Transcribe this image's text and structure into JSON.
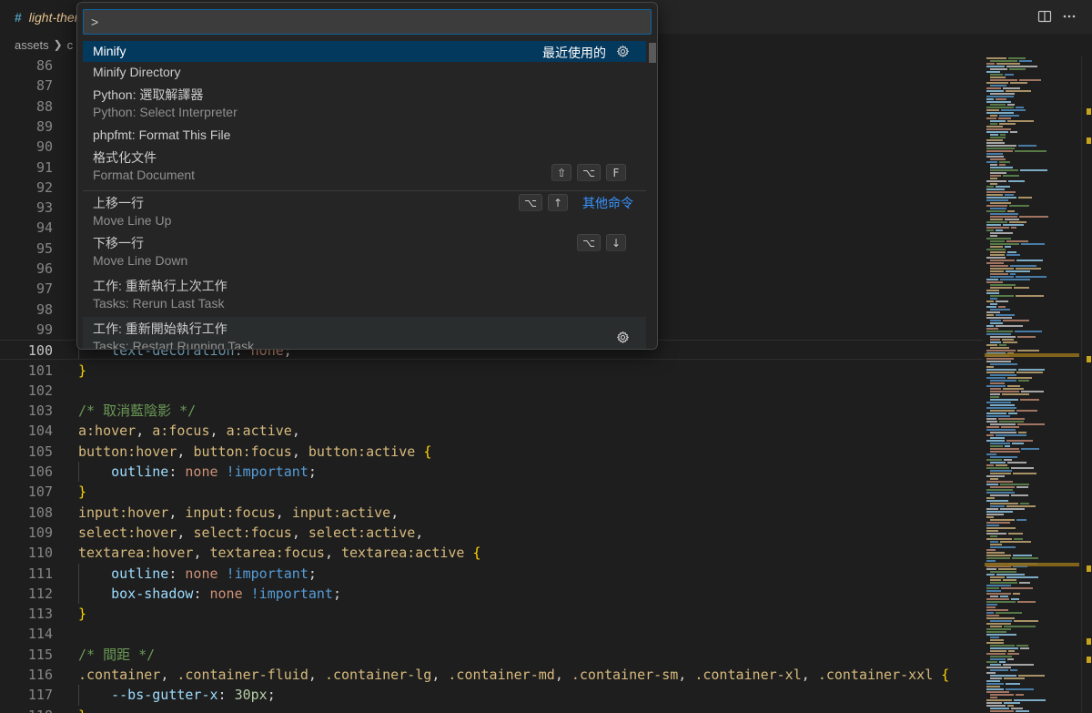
{
  "tab": {
    "icon": "#",
    "title": "light-theme.scss"
  },
  "top_actions": {
    "split_icon": "split-editor-icon",
    "more_icon": "more-actions-icon"
  },
  "breadcrumb": {
    "root": "assets",
    "next": "c"
  },
  "palette": {
    "input_value": ">",
    "items": [
      {
        "label": "Minify",
        "detail": "",
        "right_label": "最近使用的",
        "selected": true,
        "keys": [],
        "gear": true
      },
      {
        "label": "Minify Directory",
        "detail": "",
        "keys": []
      },
      {
        "label": "Python: 選取解譯器",
        "detail": "Python: Select Interpreter",
        "keys": []
      },
      {
        "label": "phpfmt: Format This File",
        "detail": "",
        "keys": []
      },
      {
        "label": "格式化文件",
        "detail": "Format Document",
        "keys": [
          "⇧",
          "⌥",
          "F"
        ]
      },
      {
        "label": "上移一行",
        "detail": "Move Line Up",
        "keys": [
          "⌥",
          "↑"
        ],
        "right_label": "其他命令"
      },
      {
        "label": "下移一行",
        "detail": "Move Line Down",
        "keys": [
          "⌥",
          "↓"
        ]
      },
      {
        "label": "工作: 重新執行上次工作",
        "detail": "Tasks: Rerun Last Task",
        "keys": []
      },
      {
        "label": "工作: 重新開始執行工作",
        "detail": "Tasks: Restart Running Task",
        "keys": [],
        "gear": true
      }
    ],
    "accent_color": "#3794ff"
  },
  "editor": {
    "current_line": 100,
    "lines": [
      {
        "n": 86,
        "tokens": []
      },
      {
        "n": 87,
        "tokens": []
      },
      {
        "n": 88,
        "tokens": []
      },
      {
        "n": 89,
        "tokens": []
      },
      {
        "n": 90,
        "tokens": []
      },
      {
        "n": 91,
        "tokens": []
      },
      {
        "n": 92,
        "tokens": []
      },
      {
        "n": 93,
        "tokens": []
      },
      {
        "n": 94,
        "tokens": []
      },
      {
        "n": 95,
        "tokens": []
      },
      {
        "n": 96,
        "tokens": []
      },
      {
        "n": 97,
        "tokens": []
      },
      {
        "n": 98,
        "tokens": []
      },
      {
        "n": 99,
        "tokens": []
      },
      {
        "n": 100,
        "tokens": [
          [
            "prop",
            "    text-decoration"
          ],
          [
            "punc",
            ": "
          ],
          [
            "val",
            "none"
          ],
          [
            "punc",
            ";"
          ]
        ]
      },
      {
        "n": 101,
        "tokens": [
          [
            "brace",
            "}"
          ]
        ]
      },
      {
        "n": 102,
        "tokens": []
      },
      {
        "n": 103,
        "tokens": [
          [
            "comment",
            "/* 取消藍陰影 */"
          ]
        ]
      },
      {
        "n": 104,
        "tokens": [
          [
            "sel",
            "a:hover"
          ],
          [
            "punc",
            ", "
          ],
          [
            "sel",
            "a:focus"
          ],
          [
            "punc",
            ", "
          ],
          [
            "sel",
            "a:active"
          ],
          [
            "punc",
            ","
          ]
        ]
      },
      {
        "n": 105,
        "tokens": [
          [
            "sel",
            "button:hover"
          ],
          [
            "punc",
            ", "
          ],
          [
            "sel",
            "button:focus"
          ],
          [
            "punc",
            ", "
          ],
          [
            "sel",
            "button:active"
          ],
          [
            "punc",
            " "
          ],
          [
            "brace",
            "{"
          ]
        ]
      },
      {
        "n": 106,
        "tokens": [
          [
            "prop",
            "    outline"
          ],
          [
            "punc",
            ": "
          ],
          [
            "val",
            "none"
          ],
          [
            "punc",
            " "
          ],
          [
            "kw",
            "!important"
          ],
          [
            "punc",
            ";"
          ]
        ]
      },
      {
        "n": 107,
        "tokens": [
          [
            "brace",
            "}"
          ]
        ]
      },
      {
        "n": 108,
        "tokens": [
          [
            "sel",
            "input:hover"
          ],
          [
            "punc",
            ", "
          ],
          [
            "sel",
            "input:focus"
          ],
          [
            "punc",
            ", "
          ],
          [
            "sel",
            "input:active"
          ],
          [
            "punc",
            ","
          ]
        ]
      },
      {
        "n": 109,
        "tokens": [
          [
            "sel",
            "select:hover"
          ],
          [
            "punc",
            ", "
          ],
          [
            "sel",
            "select:focus"
          ],
          [
            "punc",
            ", "
          ],
          [
            "sel",
            "select:active"
          ],
          [
            "punc",
            ","
          ]
        ]
      },
      {
        "n": 110,
        "tokens": [
          [
            "sel",
            "textarea:hover"
          ],
          [
            "punc",
            ", "
          ],
          [
            "sel",
            "textarea:focus"
          ],
          [
            "punc",
            ", "
          ],
          [
            "sel",
            "textarea:active"
          ],
          [
            "punc",
            " "
          ],
          [
            "brace",
            "{"
          ]
        ]
      },
      {
        "n": 111,
        "tokens": [
          [
            "prop",
            "    outline"
          ],
          [
            "punc",
            ": "
          ],
          [
            "val",
            "none"
          ],
          [
            "punc",
            " "
          ],
          [
            "kw",
            "!important"
          ],
          [
            "punc",
            ";"
          ]
        ]
      },
      {
        "n": 112,
        "tokens": [
          [
            "prop",
            "    box-shadow"
          ],
          [
            "punc",
            ": "
          ],
          [
            "val",
            "none"
          ],
          [
            "punc",
            " "
          ],
          [
            "kw",
            "!important"
          ],
          [
            "punc",
            ";"
          ]
        ]
      },
      {
        "n": 113,
        "tokens": [
          [
            "brace",
            "}"
          ]
        ]
      },
      {
        "n": 114,
        "tokens": []
      },
      {
        "n": 115,
        "tokens": [
          [
            "comment",
            "/* 間距 */"
          ]
        ]
      },
      {
        "n": 116,
        "tokens": [
          [
            "sel",
            ".container"
          ],
          [
            "punc",
            ", "
          ],
          [
            "sel",
            ".container-fluid"
          ],
          [
            "punc",
            ", "
          ],
          [
            "sel",
            ".container-lg"
          ],
          [
            "punc",
            ", "
          ],
          [
            "sel",
            ".container-md"
          ],
          [
            "punc",
            ", "
          ],
          [
            "sel",
            ".container-sm"
          ],
          [
            "punc",
            ", "
          ],
          [
            "sel",
            ".container-xl"
          ],
          [
            "punc",
            ", "
          ],
          [
            "sel",
            ".container-xxl"
          ],
          [
            "punc",
            " "
          ],
          [
            "brace",
            "{"
          ]
        ]
      },
      {
        "n": 117,
        "tokens": [
          [
            "prop",
            "    --bs-gutter-x"
          ],
          [
            "punc",
            ": "
          ],
          [
            "num",
            "30px"
          ],
          [
            "punc",
            ";"
          ]
        ]
      },
      {
        "n": 118,
        "tokens": [
          [
            "brace",
            "}"
          ]
        ]
      }
    ]
  },
  "colors": {
    "editor_bg": "#1e1e1e",
    "selection_bg": "#04395e",
    "minimap_highlight": "#8c6c1c",
    "gutter_marker": "#c8a417"
  }
}
